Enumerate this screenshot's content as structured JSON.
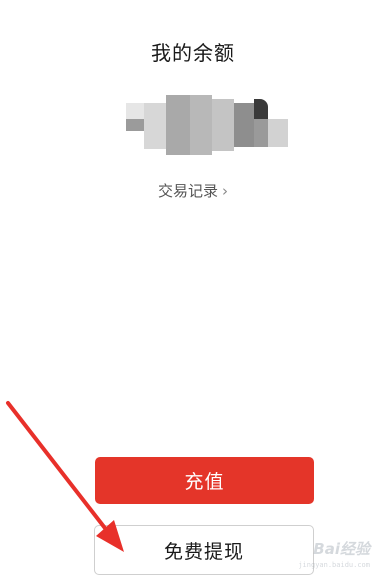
{
  "header": {
    "title": "我的余额"
  },
  "balance": {
    "value_obscured": true
  },
  "links": {
    "transactions_label": "交易记录",
    "transactions_chevron": "›"
  },
  "buttons": {
    "recharge_label": "充值",
    "withdraw_label": "免费提现"
  },
  "annotation": {
    "arrow_color": "#e8302a"
  },
  "watermark": {
    "text": "Bai经验",
    "sub": "jingyan.baidu.com"
  },
  "colors": {
    "primary_red": "#e43529",
    "text_dark": "#1a1a1a",
    "text_muted": "#555555"
  }
}
